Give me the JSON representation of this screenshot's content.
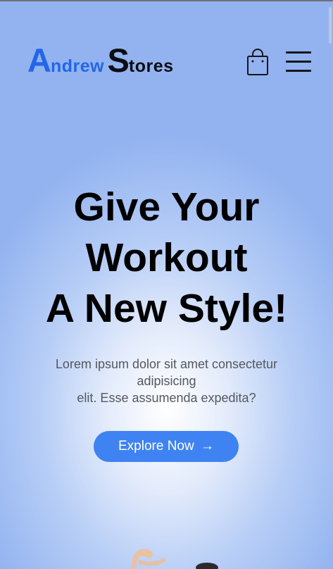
{
  "header": {
    "logo": {
      "first_initial": "A",
      "first_rest": "ndrew",
      "second_initial": "S",
      "second_rest": "tores"
    },
    "cart_icon": "shopping-bag-icon",
    "menu_icon": "hamburger-menu-icon"
  },
  "hero": {
    "title_line1": "Give Your",
    "title_line2": "Workout",
    "title_line3": "A New Style!",
    "description_line1": "Lorem ipsum dolor sit amet consectetur adipisicing",
    "description_line2": "elit. Esse assumenda expedita?",
    "cta_label": "Explore Now",
    "cta_arrow": "→"
  },
  "colors": {
    "brand_blue": "#2466e8",
    "cta_blue": "#3f82f1",
    "background_blue": "#93b3f0"
  }
}
